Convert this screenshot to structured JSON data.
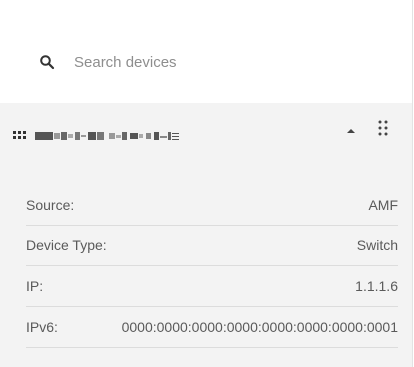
{
  "search": {
    "placeholder": "Search devices",
    "value": ""
  },
  "device": {
    "name_icon": "device-grid-icon",
    "name_redacted": true,
    "collapse_icon": "chevron-up-icon",
    "drag_icon": "drag-handle-icon",
    "details": [
      {
        "label": "Source:",
        "value": "AMF"
      },
      {
        "label": "Device Type:",
        "value": "Switch"
      },
      {
        "label": "IP:",
        "value": "1.1.1.6"
      },
      {
        "label": "IPv6:",
        "value": "0000:0000:0000:0000:0000:0000:0000:0001"
      }
    ]
  },
  "colors": {
    "card_background": "#f3f3f3",
    "divider": "#dcdcdc",
    "text": "#5a5a5a",
    "icon": "#333333"
  }
}
